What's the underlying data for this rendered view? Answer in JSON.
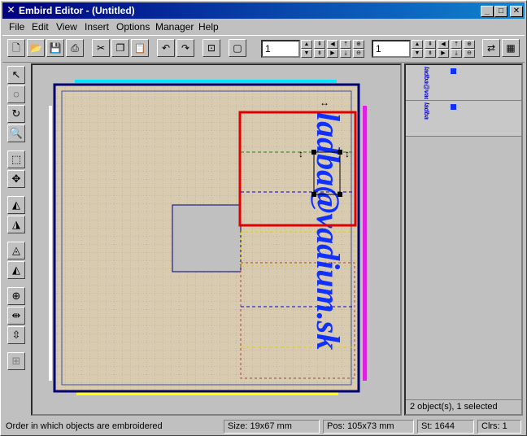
{
  "window": {
    "title": "Embird Editor - (Untitled)"
  },
  "menu": [
    "File",
    "Edit",
    "View",
    "Insert",
    "Options",
    "Manager",
    "Help"
  ],
  "toolbar": {
    "field1_value": "1",
    "field2_value": "1"
  },
  "canvas": {
    "text": "ladba@vadium.sk",
    "text_color": "#1030ff"
  },
  "right_panel": {
    "items": [
      {
        "thumb": "ladba@vadium.sk"
      },
      {
        "thumb": "ladba"
      }
    ],
    "status": "2 object(s), 1 selected"
  },
  "status": {
    "hint": "Order in which objects are embroidered",
    "size": "Size: 19x67 mm",
    "pos": "Pos: 105x73 mm",
    "stitches": "St: 1644",
    "colors": "Clrs: 1"
  }
}
